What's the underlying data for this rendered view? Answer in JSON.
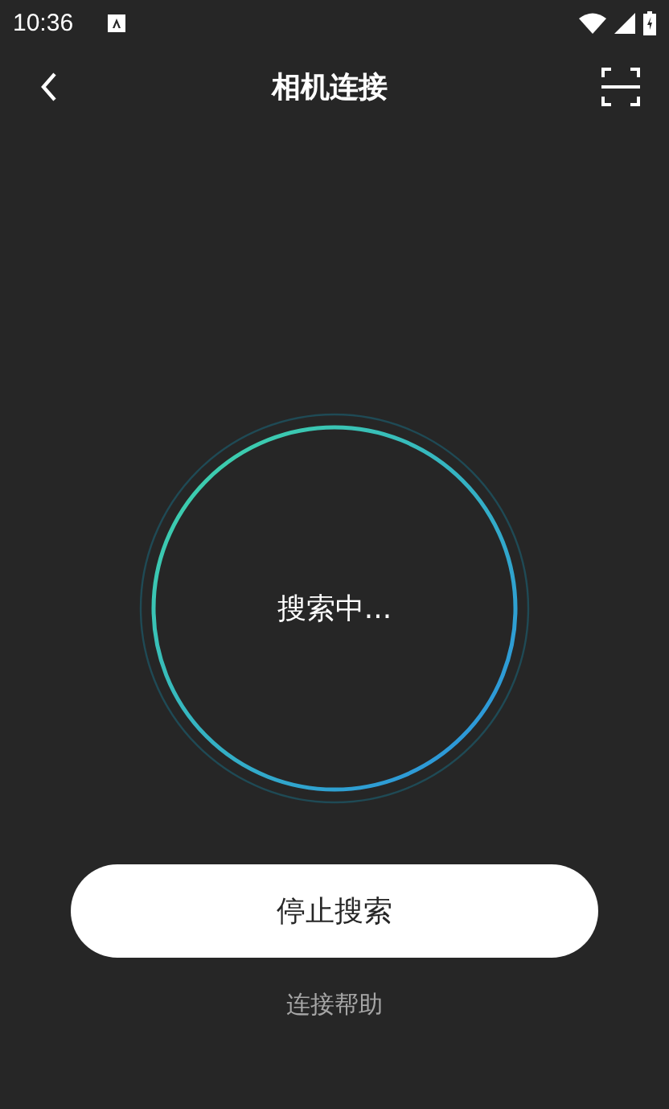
{
  "status_bar": {
    "time": "10:36"
  },
  "header": {
    "title": "相机连接"
  },
  "search": {
    "status": "搜索中..."
  },
  "stop_button": {
    "label": "停止搜索"
  },
  "help_link": {
    "label": "连接帮助"
  }
}
